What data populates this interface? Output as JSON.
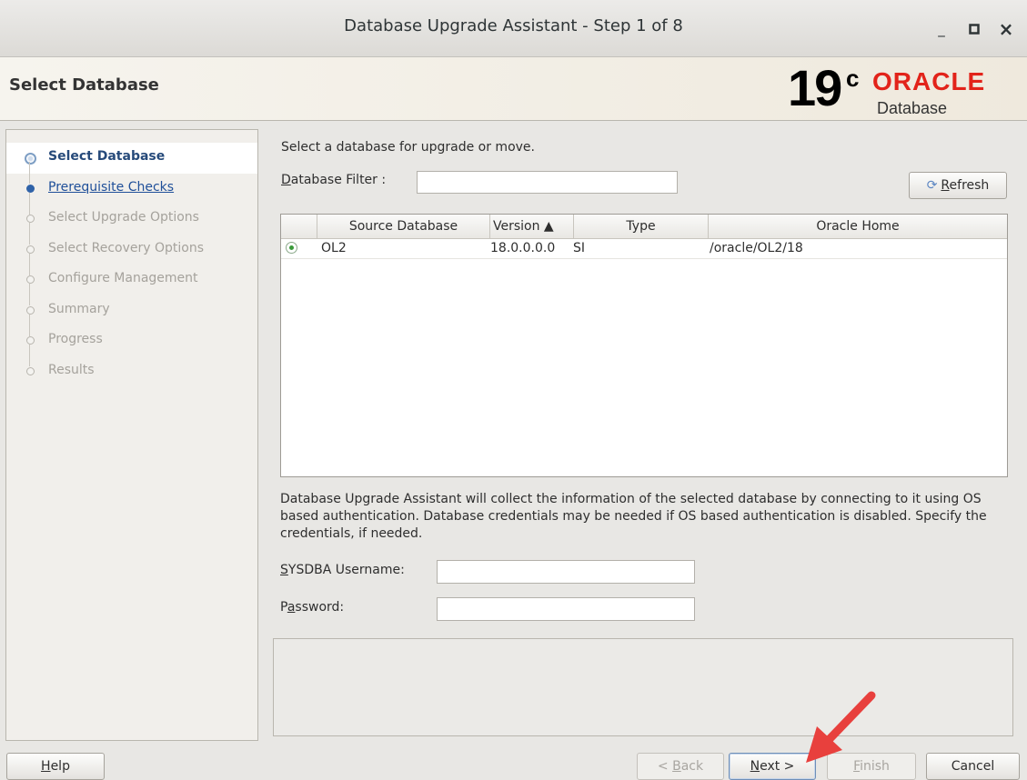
{
  "window": {
    "title": "Database Upgrade Assistant - Step 1 of 8",
    "minimize_glyph": "_",
    "maximize_glyph": "□",
    "close_glyph": "×"
  },
  "header": {
    "page_title": "Select Database",
    "logo": {
      "version": "19",
      "superscript": "c",
      "brand": "ORACLE",
      "product": "Database",
      "brand_color": "#e2231a"
    }
  },
  "steps": [
    {
      "label": "Select Database",
      "state": "active"
    },
    {
      "label": "Prerequisite Checks",
      "state": "link"
    },
    {
      "label": "Select Upgrade Options",
      "state": "disabled"
    },
    {
      "label": "Select Recovery Options",
      "state": "disabled"
    },
    {
      "label": "Configure Management",
      "state": "disabled"
    },
    {
      "label": "Summary",
      "state": "disabled"
    },
    {
      "label": "Progress",
      "state": "disabled"
    },
    {
      "label": "Results",
      "state": "disabled"
    }
  ],
  "main": {
    "instruction": "Select a database for upgrade or move.",
    "filter_label_u": "D",
    "filter_label_rest": "atabase Filter :",
    "filter_value": "",
    "refresh_u": "R",
    "refresh_rest": "efresh",
    "table": {
      "headers": {
        "source": "Source Database",
        "version": "Version ▲",
        "type": "Type",
        "home": "Oracle Home"
      },
      "rows": [
        {
          "selected": true,
          "source": "OL2",
          "version": "18.0.0.0.0",
          "type": "SI",
          "home": "/oracle/OL2/18"
        }
      ]
    },
    "info_text": "Database Upgrade Assistant will collect the information of the selected database by connecting to it using OS based authentication. Database credentials may be needed if OS based authentication is disabled. Specify the credentials, if needed.",
    "sysdba_label_u": "S",
    "sysdba_label_rest": "YSDBA Username:",
    "sysdba_value": "",
    "password_label_pre": "P",
    "password_label_u": "a",
    "password_label_rest": "ssword:",
    "password_value": ""
  },
  "footer": {
    "help_u": "H",
    "help_rest": "elp",
    "back_pre": "< ",
    "back_u": "B",
    "back_rest": "ack",
    "next_u": "N",
    "next_rest": "ext >",
    "finish_u": "F",
    "finish_rest": "inish",
    "cancel": "Cancel"
  },
  "annotation": {
    "arrow_color": "#e8403d"
  }
}
